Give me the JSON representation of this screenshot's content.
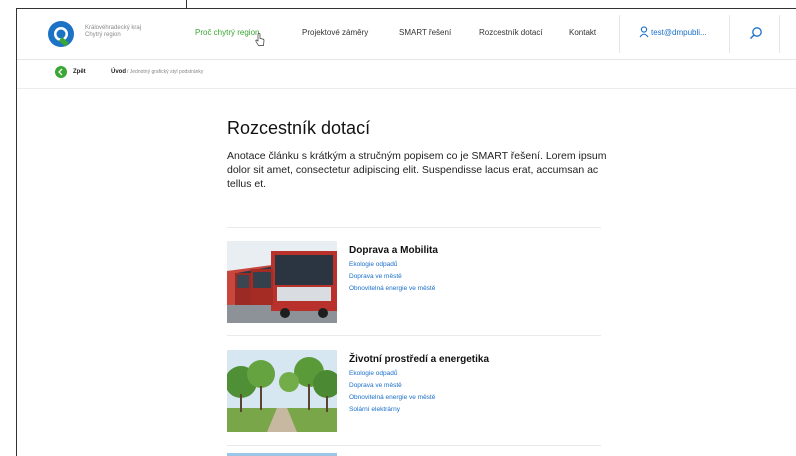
{
  "header": {
    "logo_line1": "Královéhradecký kraj",
    "logo_line2": "Chytrý region",
    "nav": [
      "Proč chytrý region",
      "Projektové záměry",
      "SMART řešení",
      "Rozcestník dotací",
      "Kontakt"
    ],
    "user": "test@dmpubli..."
  },
  "breadcrumb": {
    "back": "Zpět",
    "home": "Úvod",
    "rest": "/ Jednotný grafický styl podstránky"
  },
  "main": {
    "title": "Rozcestník dotací",
    "lead": "Anotace článku s krátkým a stručným popisem co je SMART řešení. Lorem ipsum dolor sit amet, consectetur adipiscing elit. Suspendisse lacus erat, accumsan ac tellus et.",
    "cards": [
      {
        "title": "Doprava a Mobilita",
        "links": [
          "Ekologie odpadů",
          "Doprava ve městě",
          "Obnovitelná energie ve městě"
        ]
      },
      {
        "title": "Životní prostředí a energetika",
        "links": [
          "Ekologie odpadů",
          "Doprava ve městě",
          "Obnovitelná energie ve městě",
          "Solární elektrárny"
        ]
      }
    ]
  },
  "colors": {
    "accent": "#3aa635",
    "link": "#1a6fc9",
    "logo_blue": "#1c72c4"
  }
}
